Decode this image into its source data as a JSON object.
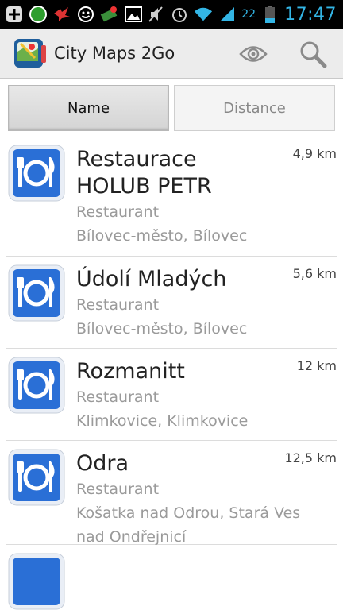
{
  "status_bar": {
    "notification_count": "22",
    "battery_level": "22",
    "time": "17:47"
  },
  "action_bar": {
    "app_title": "City Maps 2Go"
  },
  "sort_tabs": [
    {
      "label": "Name",
      "selected": true
    },
    {
      "label": "Distance",
      "selected": false
    }
  ],
  "results": [
    {
      "name": "Restaurace HOLUB PETR",
      "category": "Restaurant",
      "location": "Bílovec-město, Bílovec",
      "distance": "4,9 km",
      "icon": "restaurant-icon"
    },
    {
      "name": "Údolí Mladých",
      "category": "Restaurant",
      "location": "Bílovec-město, Bílovec",
      "distance": "5,6 km",
      "icon": "restaurant-icon"
    },
    {
      "name": "Rozmanitt",
      "category": "Restaurant",
      "location": "Klimkovice, Klimkovice",
      "distance": "12 km",
      "icon": "restaurant-icon"
    },
    {
      "name": "Odra",
      "category": "Restaurant",
      "location": "Košatka nad Odrou, Stará Ves nad Ondřejnicí",
      "distance": "12,5 km",
      "icon": "restaurant-icon"
    }
  ],
  "colors": {
    "status_accent": "#33b5e5",
    "poi_icon_blue": "#2a6fd6",
    "action_bar_bg": "#ececec"
  }
}
